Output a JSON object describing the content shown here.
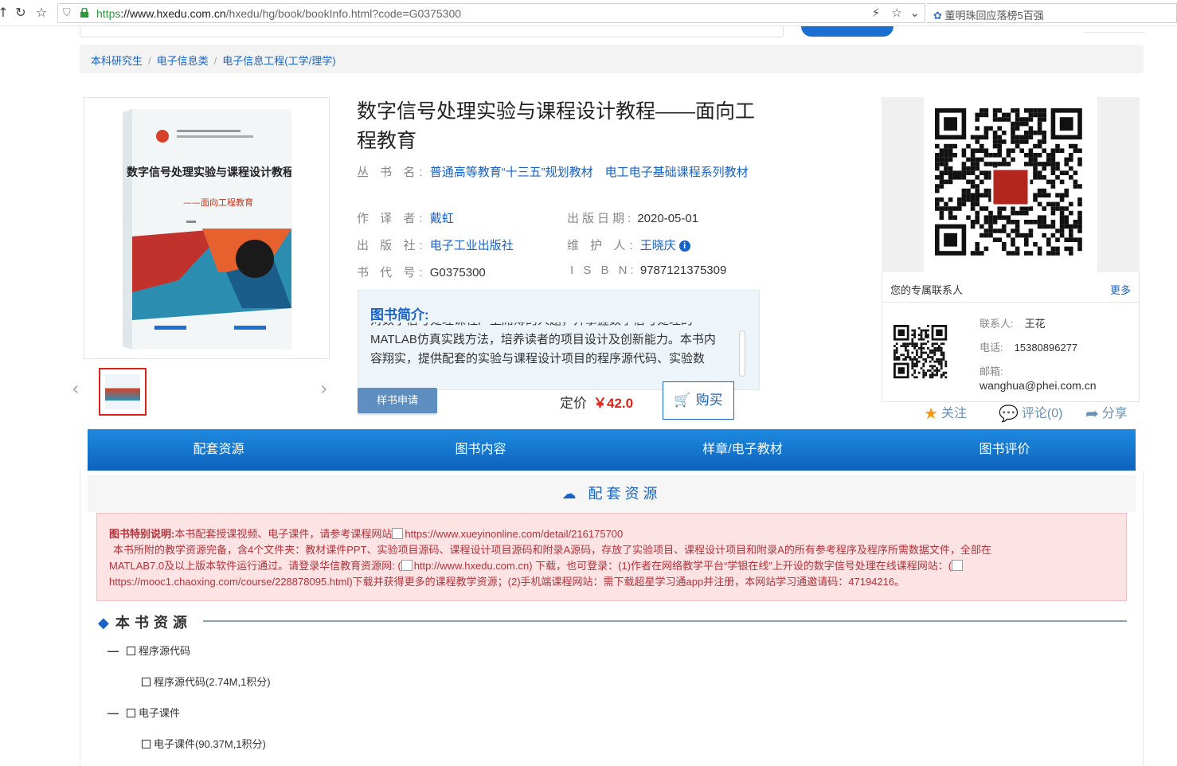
{
  "browser": {
    "url_proto": "https",
    "url_host": "://www.hxedu.com.cn",
    "url_path": "/hxedu/hg/book/bookInfo.html?code=G0375300",
    "search_hint": "董明珠回应落榜5百强"
  },
  "breadcrumb": [
    "本科研究生",
    "电子信息类",
    "电子信息工程(工学/理学)"
  ],
  "book": {
    "title": "数字信号处理实验与课程设计教程——面向工程教育",
    "series_label": "丛 书 名:",
    "series_value": "普通高等教育“十三五”规划教材　电工电子基础课程系列教材",
    "author_label": "作 译 者:",
    "author_value": "戴虹",
    "pubdate_label": "出版日期:",
    "pubdate_value": "2020-05-01",
    "publisher_label": "出 版 社:",
    "publisher_value": "电子工业出版社",
    "maintainer_label": "维 护 人:",
    "maintainer_value": "王晓庆",
    "code_label": "书 代 号:",
    "code_value": "G0375300",
    "isbn_label": "I S B N:",
    "isbn_value": "9787121375309",
    "cover_title": "数字信号处理实验与课程设计教程",
    "cover_subtitle": "——面向工程教育"
  },
  "intro": {
    "heading": "图书简介:",
    "cut_line": "对数字信号处理课程厂王席薄的人题，开掌握数字信号处理的",
    "line1": "MATLAB仿真实践方法，培养读者的项目设计及创新能力。本书内",
    "line2": "容翔实，提供配套的实验与课程设计项目的程序源代码、实验数"
  },
  "purchase": {
    "sample_label": "样书申请",
    "price_label": "定价",
    "price_value": "￥42.0",
    "buy_label": "购买"
  },
  "contact": {
    "heading": "您的专属联系人",
    "more": "更多",
    "name_label": "联系人:",
    "name_value": "王花",
    "phone_label": "电话:",
    "phone_value": "15380896277",
    "email_label": "邮箱:",
    "email_value": "wanghua@phei.com.cn"
  },
  "actions": {
    "follow": "关注",
    "comment": "评论(0)",
    "share": "分享"
  },
  "tabs": [
    "配套资源",
    "图书内容",
    "样章/电子教材",
    "图书评价"
  ],
  "resources": {
    "heading": "配套资源",
    "notice_bold": "图书特别说明:",
    "notice_1": "本书配套授课视频、电子课件，请参考课程网站",
    "notice_url1": "https://www.xueyinonline.com/detail/216175700",
    "notice_2": "本书所附的教学资源完备，含4个文件夹：教材课件PPT、实验项目源码、课程设计项目源码和附录A源码，存放了实验项目、课程设计项目和附录A的所有参考程序及程序所需数据文件，全部在",
    "notice_3a": "MATLAB7.0及以上版本软件运行通过。请登录华信教育资源网: (",
    "notice_url2": "http://www.hxedu.com.cn",
    "notice_3b": ") 下载，也可登录：(1)作者在网络教学平台“学银在线”上开设的数字信号处理在线课程网站：(",
    "notice_4": "https://mooc1.chaoxing.com/course/228878095.html)下载并获得更多的课程教学资源；(2)手机端课程网站：需下载超星学习通app并注册，本网站学习通邀请码：47194216。"
  },
  "book_resources": {
    "heading": "本书资源",
    "folders": [
      {
        "name": "程序源代码",
        "file": "程序源代码(2.74M,1积分)"
      },
      {
        "name": "电子课件",
        "file": "电子课件(90.37M,1积分)"
      }
    ]
  },
  "colors": {
    "accent": "#1a63c6",
    "tab_bar": "#1474cf",
    "price": "#d9241c",
    "notice_bg": "#fde3e4"
  }
}
